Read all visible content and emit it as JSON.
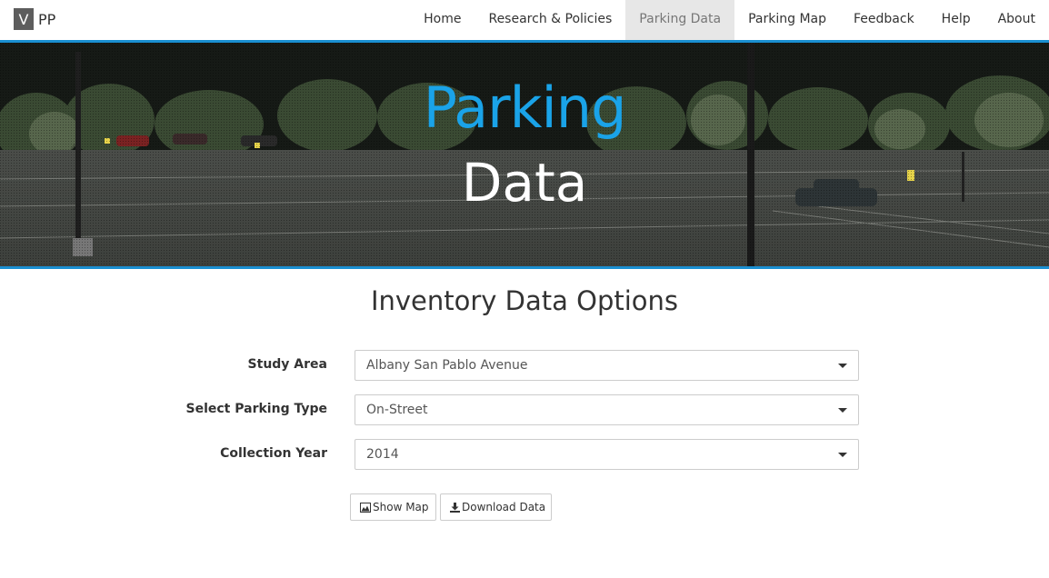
{
  "brand": {
    "logo_letter": "V",
    "name": "PP"
  },
  "nav": {
    "items": [
      {
        "label": "Home",
        "active": false
      },
      {
        "label": "Research & Policies",
        "active": false
      },
      {
        "label": "Parking Data",
        "active": true
      },
      {
        "label": "Parking Map",
        "active": false
      },
      {
        "label": "Feedback",
        "active": false
      },
      {
        "label": "Help",
        "active": false
      },
      {
        "label": "About",
        "active": false
      }
    ]
  },
  "hero": {
    "title_line1": "Parking",
    "title_line2": "Data"
  },
  "main": {
    "title": "Inventory Data Options",
    "fields": [
      {
        "label": "Study Area",
        "value": "Albany San Pablo Avenue"
      },
      {
        "label": "Select Parking Type",
        "value": "On-Street"
      },
      {
        "label": "Collection Year",
        "value": "2014"
      }
    ],
    "buttons": {
      "show_map": "Show Map",
      "download": "Download Data"
    }
  },
  "colors": {
    "accent": "#1a8fd1",
    "title_blue": "#1aa3e8"
  },
  "icons": [
    "chart-area-icon",
    "download-icon",
    "caret-down-icon"
  ]
}
